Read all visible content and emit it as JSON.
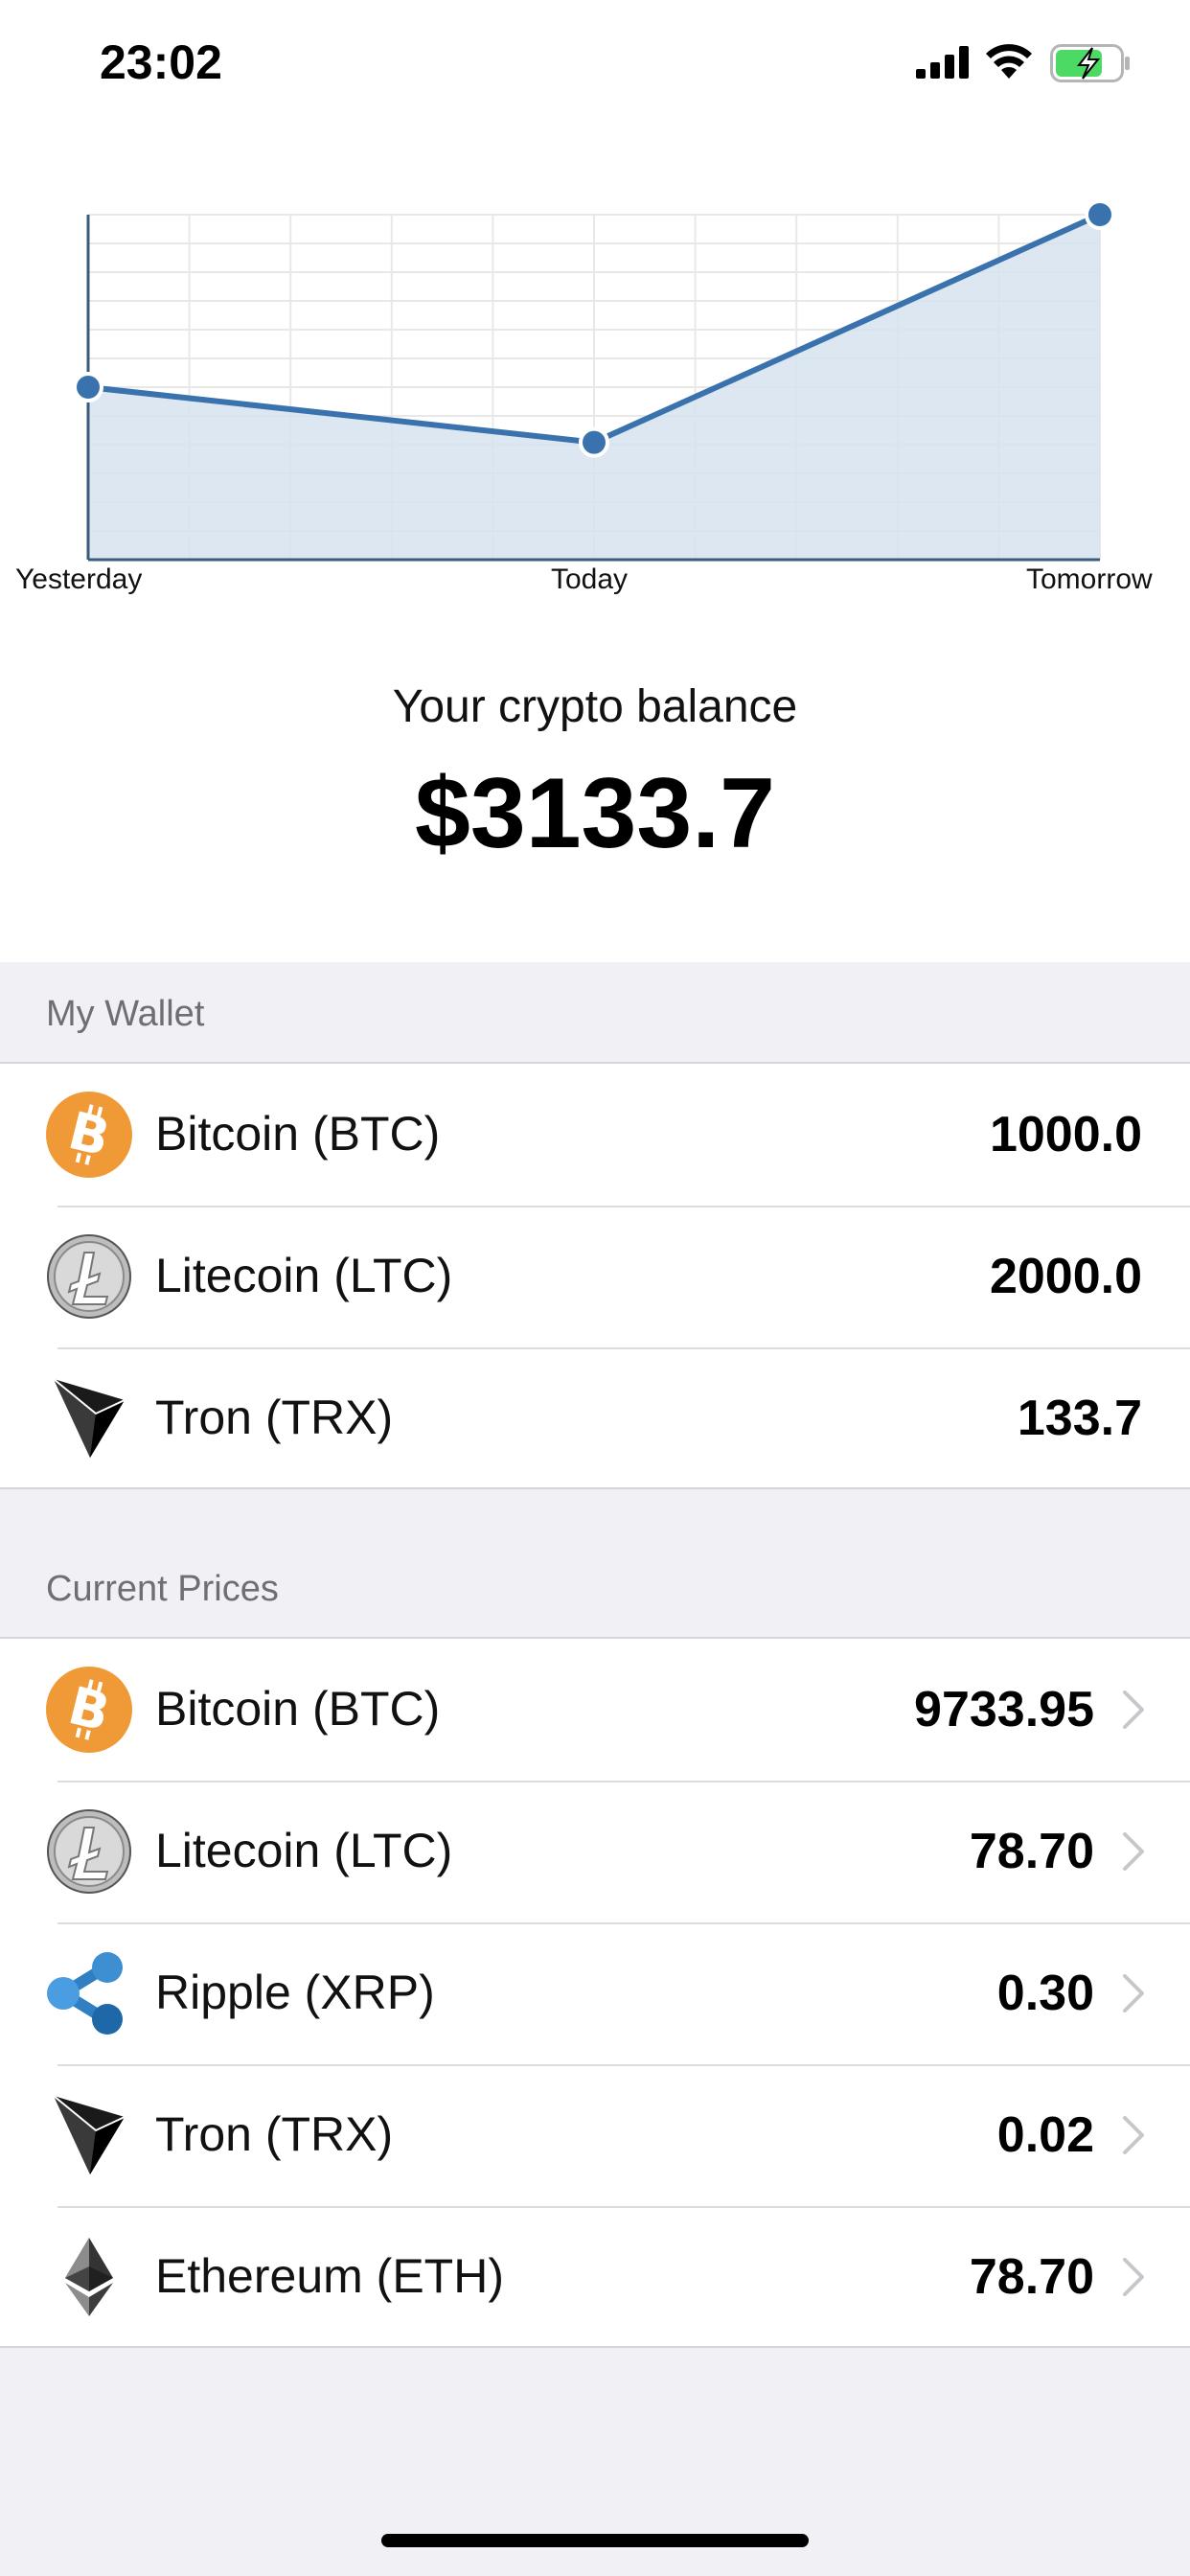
{
  "status_bar": {
    "time": "23:02",
    "icons": [
      "signal-icon",
      "wifi-icon",
      "battery-charging-icon"
    ],
    "battery_color": "#4cd964"
  },
  "chart_data": {
    "type": "area",
    "categories": [
      "Yesterday",
      "Today",
      "Tomorrow"
    ],
    "x": [
      "Yesterday",
      "Today",
      "Tomorrow"
    ],
    "values": [
      0.5,
      0.34,
      1.0
    ],
    "title": "",
    "xlabel": "",
    "ylabel": "",
    "ylim": [
      0,
      1
    ],
    "grid": true,
    "line_color": "#3a72ad",
    "fill_color": "#d6e3ef"
  },
  "balance": {
    "caption": "Your crypto balance",
    "value": "$3133.7"
  },
  "wallet": {
    "header": "My Wallet",
    "items": [
      {
        "name": "Bitcoin (BTC)",
        "value": "1000.0",
        "icon": "bitcoin-icon"
      },
      {
        "name": "Litecoin (LTC)",
        "value": "2000.0",
        "icon": "litecoin-icon"
      },
      {
        "name": "Tron (TRX)",
        "value": "133.7",
        "icon": "tron-icon"
      }
    ]
  },
  "prices": {
    "header": "Current Prices",
    "items": [
      {
        "name": "Bitcoin (BTC)",
        "value": "9733.95",
        "icon": "bitcoin-icon"
      },
      {
        "name": "Litecoin (LTC)",
        "value": "78.70",
        "icon": "litecoin-icon"
      },
      {
        "name": "Ripple (XRP)",
        "value": "0.30",
        "icon": "ripple-icon"
      },
      {
        "name": "Tron (TRX)",
        "value": "0.02",
        "icon": "tron-icon"
      },
      {
        "name": "Ethereum (ETH)",
        "value": "78.70",
        "icon": "ethereum-icon"
      }
    ]
  },
  "colors": {
    "bitcoin": "#f09a37",
    "ripple": "#3d8fd1",
    "background": "#f0f0f5",
    "section_text": "#6e6e73"
  }
}
